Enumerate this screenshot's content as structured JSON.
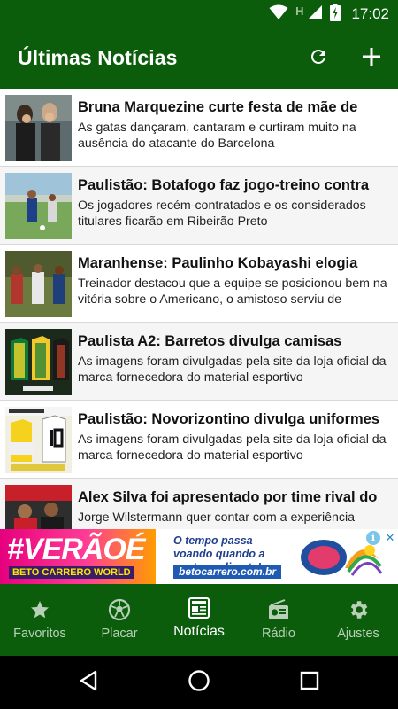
{
  "status_bar": {
    "time": "17:02",
    "network_letter": "H"
  },
  "app_bar": {
    "title": "Últimas Notícias"
  },
  "news": [
    {
      "title": "Bruna Marquezine curte festa de mãe de",
      "description": "As gatas dançaram, cantaram e curtiram muito na ausência do atacante do Barcelona"
    },
    {
      "title": "Paulistão: Botafogo faz jogo-treino contra",
      "description": "Os jogadores recém-contratados e os considerados titulares ficarão em Ribeirão Preto"
    },
    {
      "title": "Maranhense: Paulinho Kobayashi elogia",
      "description": "Treinador destacou que a equipe se posicionou bem na vitória sobre o Americano, o amistoso serviu de"
    },
    {
      "title": "Paulista A2: Barretos divulga camisas",
      "description": "As imagens foram divulgadas pela site da loja oficial da marca fornecedora do material esportivo"
    },
    {
      "title": "Paulistão: Novorizontino divulga uniformes",
      "description": "As imagens foram divulgadas pela site da loja oficial da marca fornecedora do material esportivo"
    },
    {
      "title": "Alex Silva foi apresentado por time rival do",
      "description": "Jorge Wilstermann quer contar com a experiência"
    }
  ],
  "ad": {
    "brand_text": "#VERÃOÉ",
    "brand_sub": "BETO CARRERO WORLD",
    "slogan": "O tempo passa voando quando a gente se diverte!",
    "url": "betocarrero.com.br",
    "info_symbol": "i",
    "close_symbol": "✕"
  },
  "bottom_nav": [
    {
      "label": "Favoritos",
      "icon": "star-icon"
    },
    {
      "label": "Placar",
      "icon": "soccer-ball-icon"
    },
    {
      "label": "Notícias",
      "icon": "newspaper-icon",
      "active": true
    },
    {
      "label": "Rádio",
      "icon": "radio-icon"
    },
    {
      "label": "Ajustes",
      "icon": "gear-icon"
    }
  ],
  "colors": {
    "primary": "#0b5d0b",
    "nav_inactive": "#b8cfb8",
    "ad_pink": "#e6007e"
  }
}
